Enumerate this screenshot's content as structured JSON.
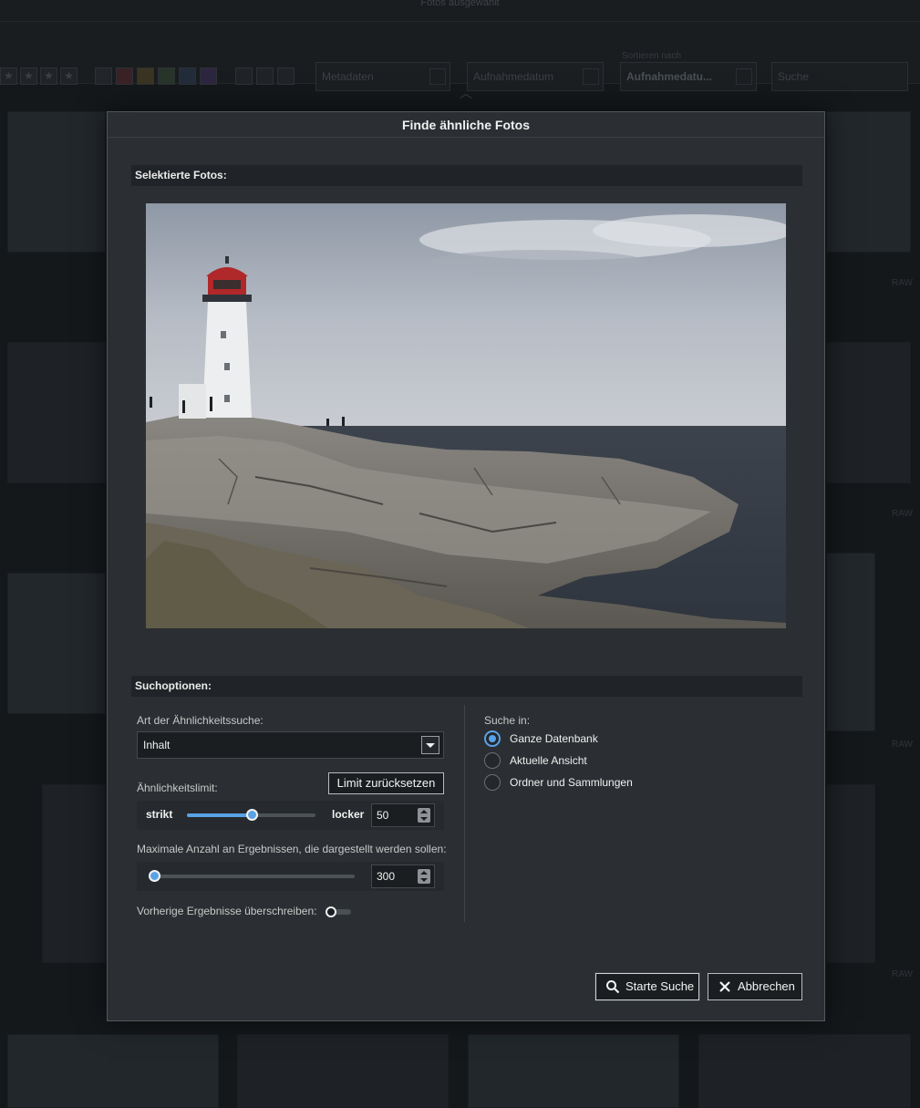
{
  "background": {
    "topbar_text": "Fotos ausgewählt",
    "filters": {
      "metadata_select": "Metadaten",
      "date_select": "Aufnahmedatum",
      "sort_label": "Sortieren nach",
      "sort_select": "Aufnahmedatu...",
      "search_placeholder": "Suche"
    },
    "thumb_badge": "RAW"
  },
  "dialog": {
    "title": "Finde ähnliche Fotos",
    "selected_header": "Selektierte Fotos:",
    "options_header": "Suchoptionen:",
    "similarity_type": {
      "label": "Art der Ähnlichkeitssuche:",
      "value": "Inhalt"
    },
    "similarity_limit": {
      "label": "Ähnlichkeitslimit:",
      "reset_button": "Limit zurücksetzen",
      "min_label": "strikt",
      "max_label": "locker",
      "value": "50",
      "fraction": 0.5
    },
    "max_results": {
      "label": "Maximale Anzahl an Ergebnissen, die dargestellt werden sollen:",
      "value": "300",
      "fraction": 0.0
    },
    "overwrite": {
      "label": "Vorherige Ergebnisse überschreiben:",
      "on": false
    },
    "search_in": {
      "label": "Suche in:",
      "options": [
        "Ganze Datenbank",
        "Aktuelle Ansicht",
        "Ordner und Sammlungen"
      ],
      "selected": 0
    },
    "buttons": {
      "start": "Starte Suche",
      "cancel": "Abbrechen"
    }
  },
  "colors": {
    "accent": "#5aa2e6",
    "dialog_bg": "#2b2f33",
    "section_bg": "#202327"
  }
}
